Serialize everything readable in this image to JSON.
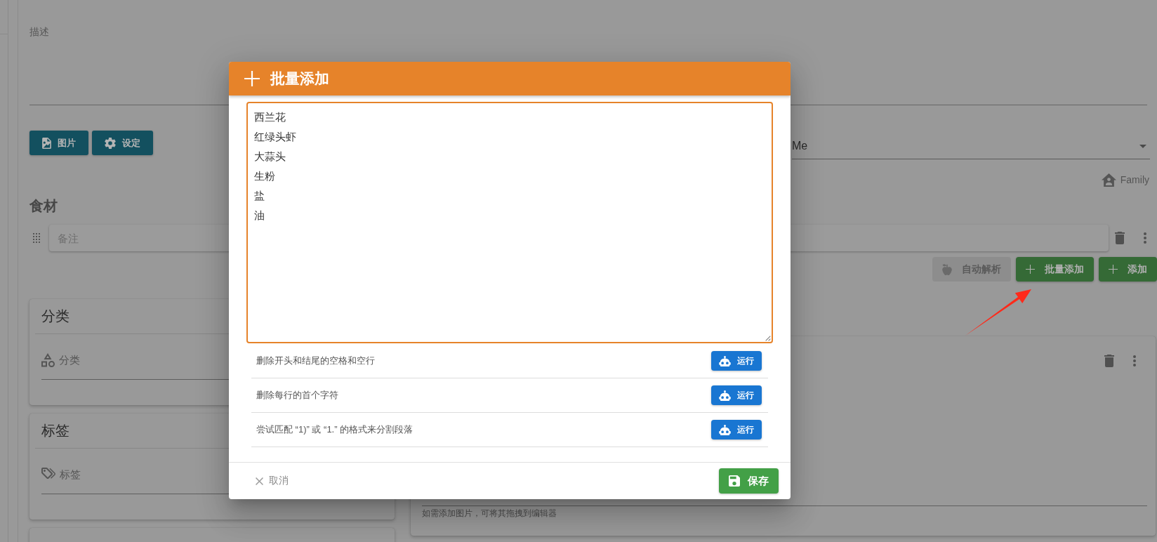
{
  "page": {
    "description_field": {
      "label": "描述"
    },
    "media_buttons": [
      {
        "label": "图片"
      },
      {
        "label": "设定"
      }
    ],
    "owner_select": {
      "value": "Me"
    },
    "visibility": {
      "label": "Family"
    },
    "ingredients": {
      "title": "食材",
      "items": [
        {
          "placeholder": "备注"
        }
      ],
      "actions": [
        {
          "label": "自动解析",
          "disabled": true
        },
        {
          "label": "批量添加",
          "disabled": false
        },
        {
          "label": "添加",
          "disabled": false
        }
      ]
    },
    "side_cards": [
      {
        "title": "分类",
        "field_label": "分类"
      },
      {
        "title": "标签",
        "field_label": "标签"
      }
    ],
    "editor": {
      "hint": "如需添加图片，可将其拖拽到编辑器"
    }
  },
  "dialog": {
    "title": "批量添加",
    "lines": [
      "西兰花",
      "红绿头虾",
      "大蒜头",
      "生粉",
      "盐",
      "油"
    ],
    "tools": [
      {
        "description": "删除开头和结尾的空格和空行",
        "button": "运行"
      },
      {
        "description": "删除每行的首个字符",
        "button": "运行"
      },
      {
        "description": "尝试匹配 “1)” 或 “1.” 的格式来分割段落",
        "button": "运行"
      }
    ],
    "cancel": "取消",
    "save": "保存"
  }
}
